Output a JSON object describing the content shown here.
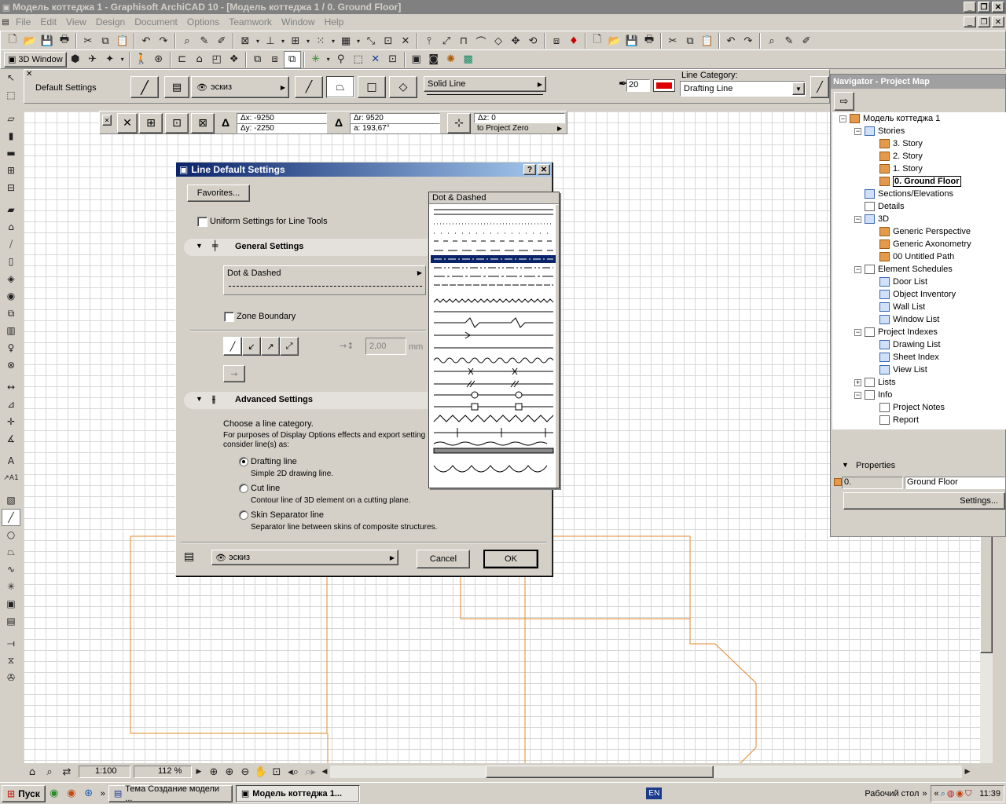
{
  "window": {
    "title": "Модель коттеджа 1 - Graphisoft ArchiCAD 10 - [Модель коттеджа 1 / 0. Ground Floor]"
  },
  "menu": [
    "File",
    "Edit",
    "View",
    "Design",
    "Document",
    "Options",
    "Teamwork",
    "Window",
    "Help"
  ],
  "toolbar2": {
    "window_button": "3D Window"
  },
  "infobox": {
    "default_settings": "Default Settings",
    "layer": "эскиз",
    "line_type": "Solid Line",
    "pen_number": "20",
    "line_category_label": "Line Category:",
    "line_category_value": "Drafting Line"
  },
  "coords": {
    "dx": "Δx: -9250",
    "dy": "Δy: -2250",
    "dr": "Δr: 9520",
    "angle": "a: 193,67°",
    "dz": "Δz: 0",
    "to_zero": "to Project Zero"
  },
  "dialog": {
    "title": "Line Default Settings",
    "favorites": "Favorites...",
    "uniform": "Uniform Settings for Line Tools",
    "general_settings": "General Settings",
    "line_type": "Dot & Dashed",
    "zone_boundary": "Zone Boundary",
    "arrow_size": "2,00",
    "arrow_unit": "mm",
    "advanced_settings": "Advanced Settings",
    "choose_category": "Choose a line category.",
    "purposes1": "For purposes of Display Options effects and export setting",
    "purposes2": "consider line(s) as:",
    "drafting_line": "Drafting line",
    "drafting_desc": "Simple 2D drawing line.",
    "cut_line": "Cut line",
    "cut_desc": "Contour line of 3D element on a cutting plane.",
    "skin_line": "Skin Separator line",
    "skin_desc": "Separator line between skins of composite structures.",
    "layer": "эскиз",
    "cancel": "Cancel",
    "ok": "OK"
  },
  "popup": {
    "title": "Dot & Dashed"
  },
  "navigator": {
    "title": "Navigator - Project Map",
    "root": "Модель коттеджа 1",
    "stories": "Stories",
    "story3": "3. Story",
    "story2": "2. Story",
    "story1": "1. Story",
    "story0": "0. Ground Floor",
    "sections": "Sections/Elevations",
    "details": "Details",
    "three_d": "3D",
    "generic_perspective": "Generic Perspective",
    "generic_axonometry": "Generic Axonometry",
    "untitled_path": "00 Untitled Path",
    "schedules": "Element Schedules",
    "door_list": "Door List",
    "object_inventory": "Object Inventory",
    "wall_list": "Wall List",
    "window_list": "Window List",
    "indexes": "Project Indexes",
    "drawing_list": "Drawing List",
    "sheet_index": "Sheet Index",
    "view_list": "View List",
    "lists": "Lists",
    "info": "Info",
    "project_notes": "Project Notes",
    "report": "Report",
    "properties": "Properties",
    "prop_id": "0.",
    "prop_name": "Ground Floor",
    "settings": "Settings..."
  },
  "status": {
    "scale": "1:100",
    "zoom": "112 %"
  },
  "taskbar": {
    "start": "Пуск",
    "task1": "Тема Создание модели ...",
    "task2": "Модель коттеджа 1...",
    "lang": "EN",
    "desktop": "Рабочий стол",
    "clock": "11:39"
  },
  "colors": {
    "accent": "#0a246a",
    "plan_lines": "#e08a2a",
    "pen_color": "#e00000"
  }
}
